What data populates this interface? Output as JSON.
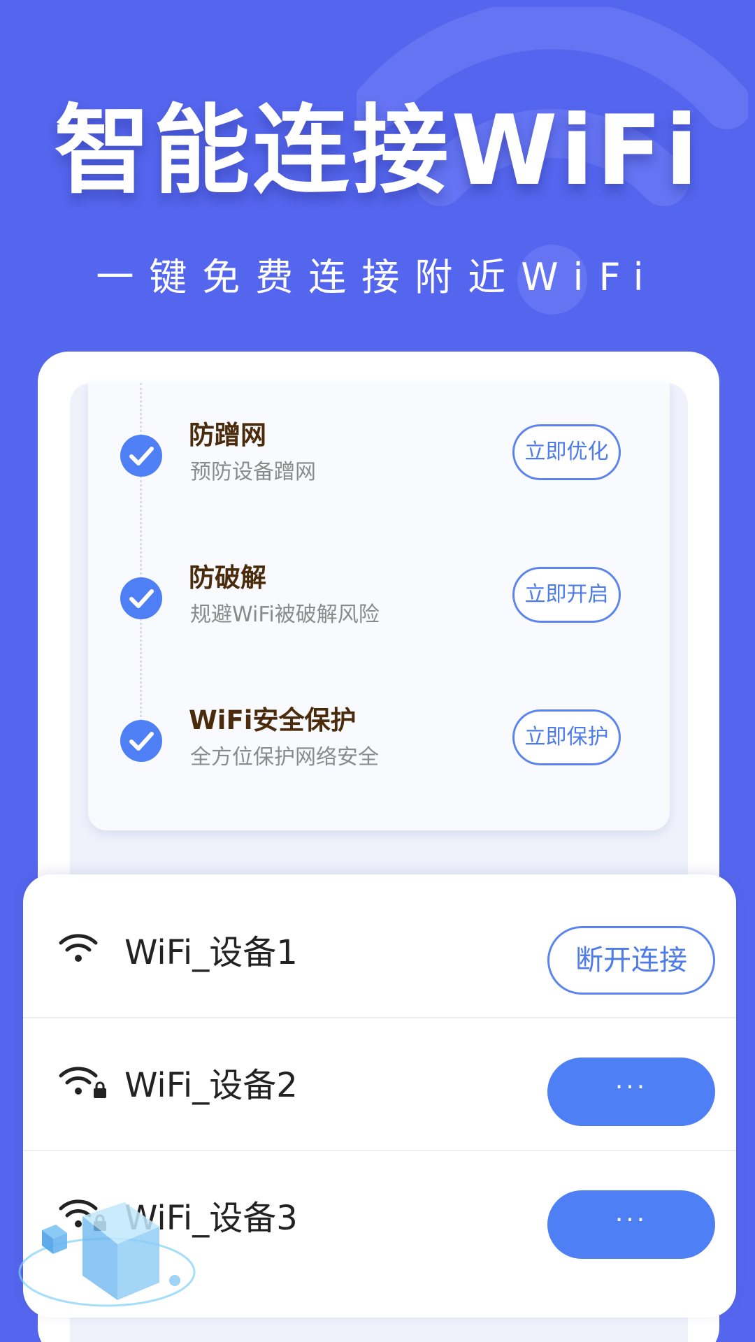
{
  "hero": {
    "title": "智能连接WiFi",
    "subtitle": "一键免费连接附近WiFi"
  },
  "features": [
    {
      "title": "防蹭网",
      "desc": "预防设备蹭网",
      "button": "立即优化",
      "icon": "check-circle-icon"
    },
    {
      "title": "防破解",
      "desc": "规避WiFi被破解风险",
      "button": "立即开启",
      "icon": "check-circle-icon"
    },
    {
      "title": "WiFi安全保护",
      "desc": "全方位保护网络安全",
      "button": "立即保护",
      "icon": "check-circle-icon"
    }
  ],
  "wifi_list": [
    {
      "name": "WiFi_设备1",
      "button": "断开连接",
      "locked": false,
      "icon": "wifi-icon"
    },
    {
      "name": "WiFi_设备2",
      "button": "···",
      "locked": true,
      "icon": "wifi-icon"
    },
    {
      "name": "WiFi_设备3",
      "button": "···",
      "locked": true,
      "icon": "wifi-icon"
    }
  ],
  "colors": {
    "background": "#5566ee",
    "accent": "#4f7ff5",
    "check": "#4f7ff5",
    "feature_title": "#4a2b0b"
  }
}
